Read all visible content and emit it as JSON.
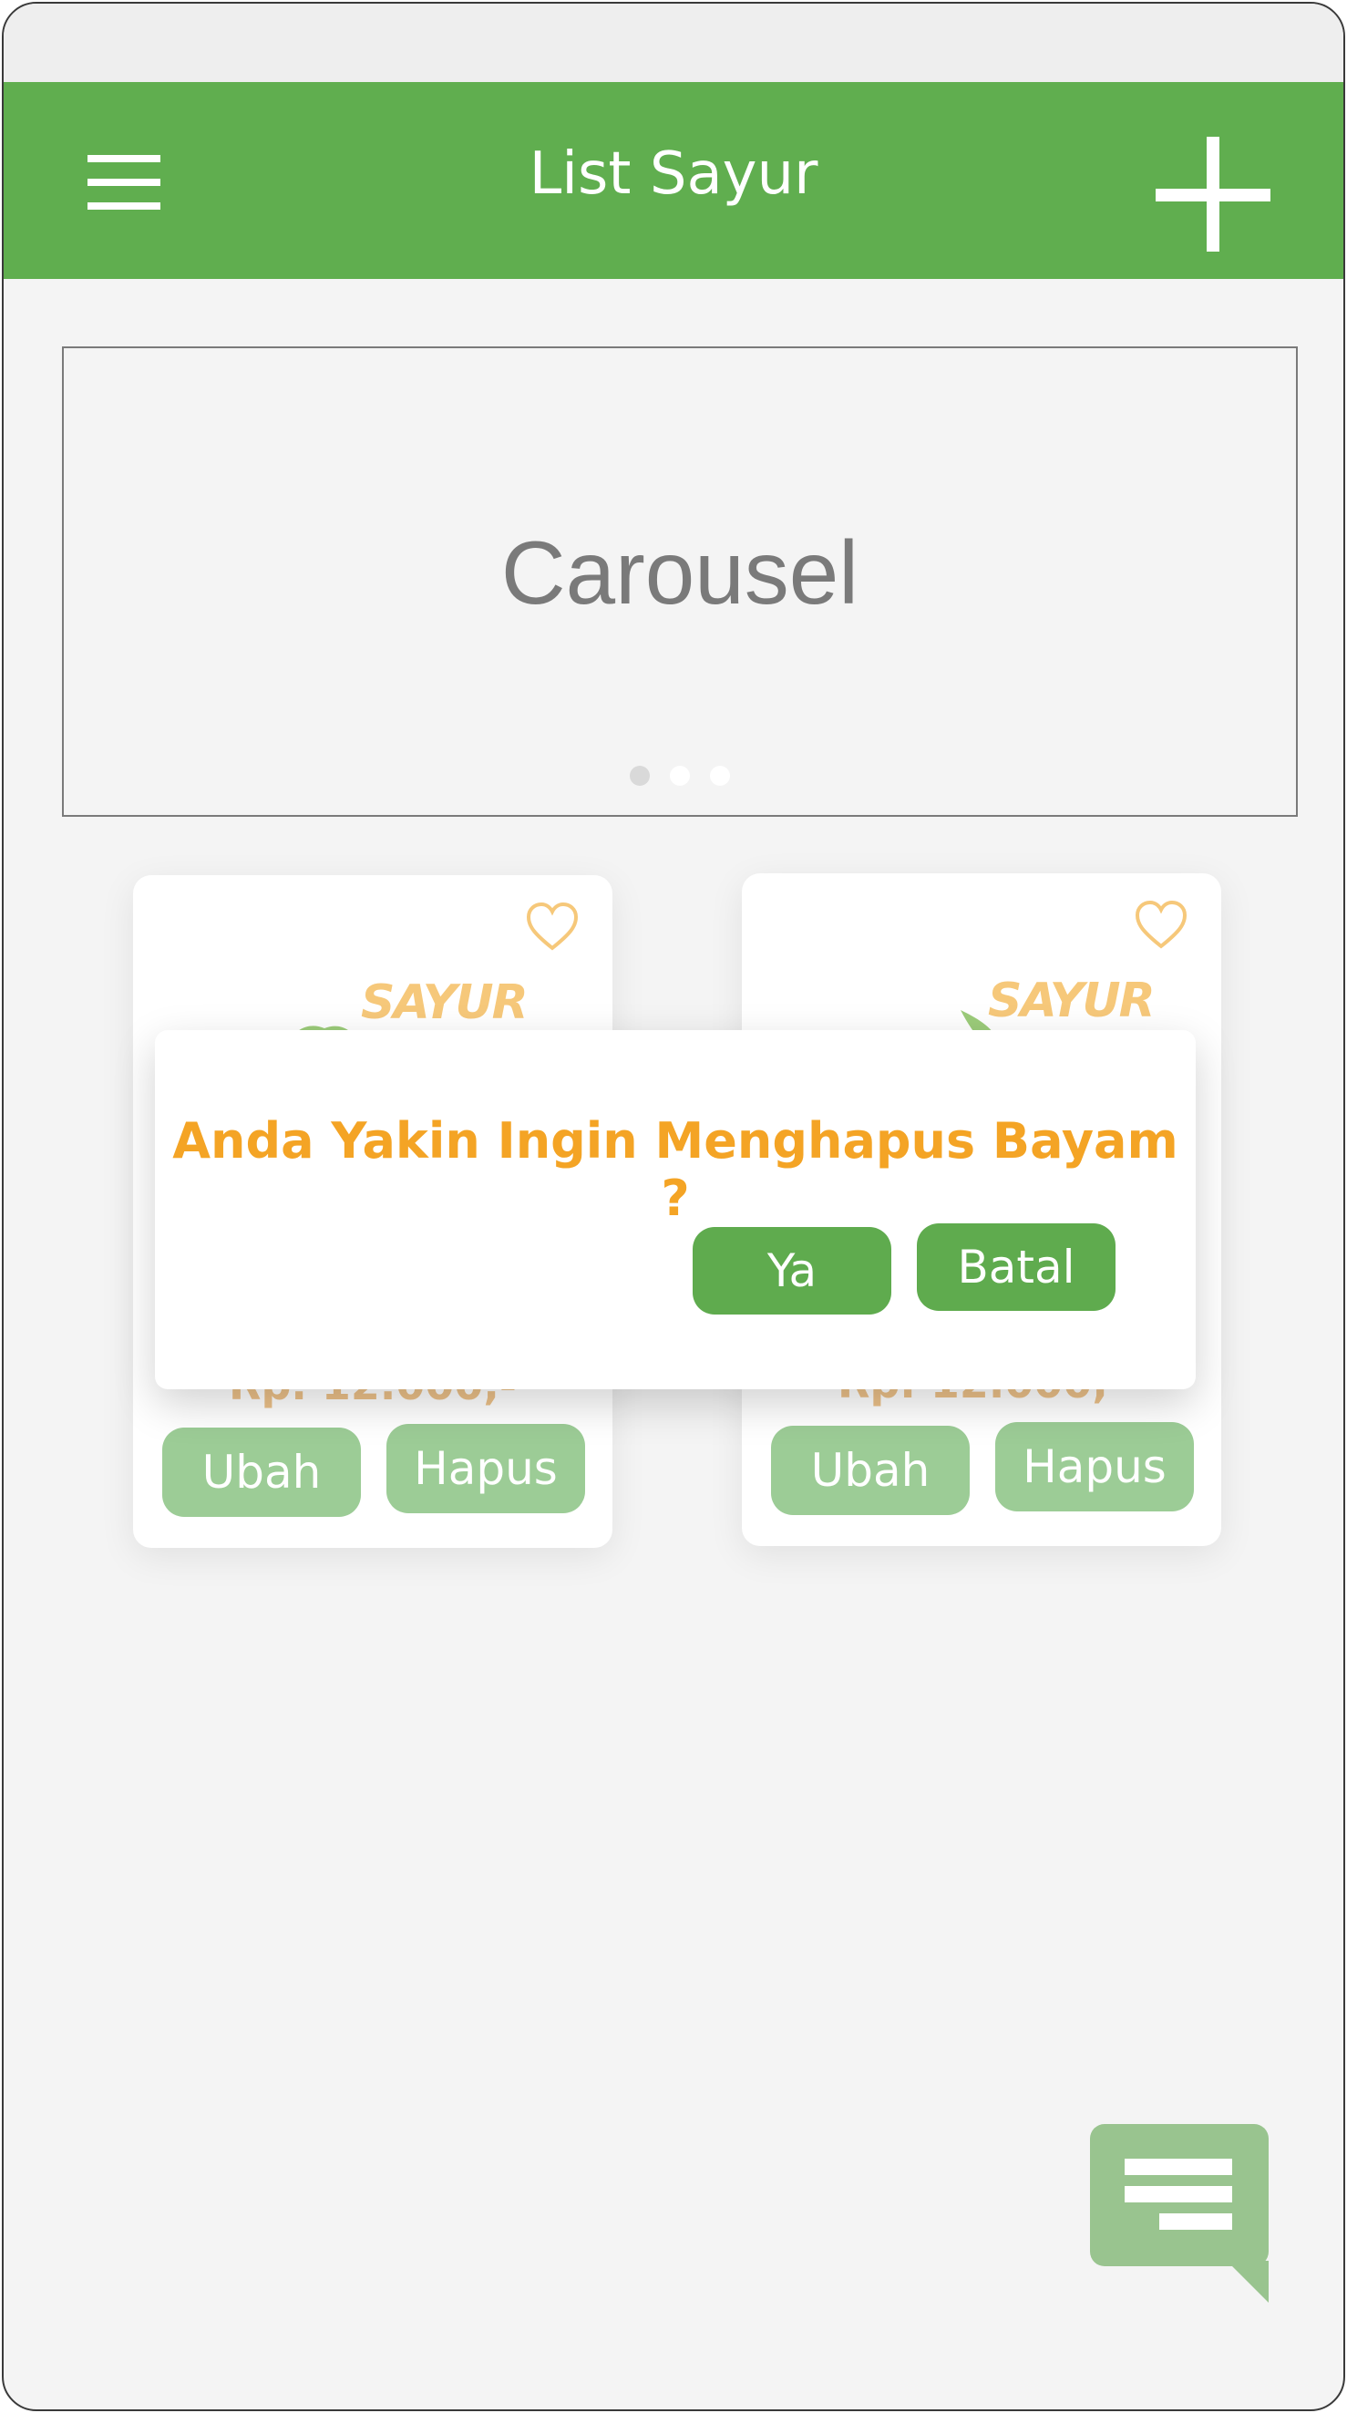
{
  "header": {
    "title": "List Sayur",
    "menu_icon": "hamburger-menu-icon",
    "add_icon": "plus-icon",
    "color": "#60ae4f"
  },
  "carousel": {
    "label": "Carousel",
    "pages": 3,
    "active_page": 1
  },
  "cards": [
    {
      "logo": "SAYUR",
      "price": "Rp. 12.000,-",
      "edit_label": "Ubah",
      "delete_label": "Hapus",
      "favorite_icon": "heart-icon"
    },
    {
      "logo": "SAYUR",
      "price": "Rp. 12.000,-",
      "edit_label": "Ubah",
      "delete_label": "Hapus",
      "favorite_icon": "heart-icon"
    }
  ],
  "dialog": {
    "message": "Anda Yakin Ingin Menghapus Bayam ?",
    "confirm_label": "Ya",
    "cancel_label": "Batal",
    "text_color": "#f4a425",
    "button_color": "#5fab4e"
  },
  "chat": {
    "icon": "chat-message-icon",
    "color": "#99c48f"
  }
}
